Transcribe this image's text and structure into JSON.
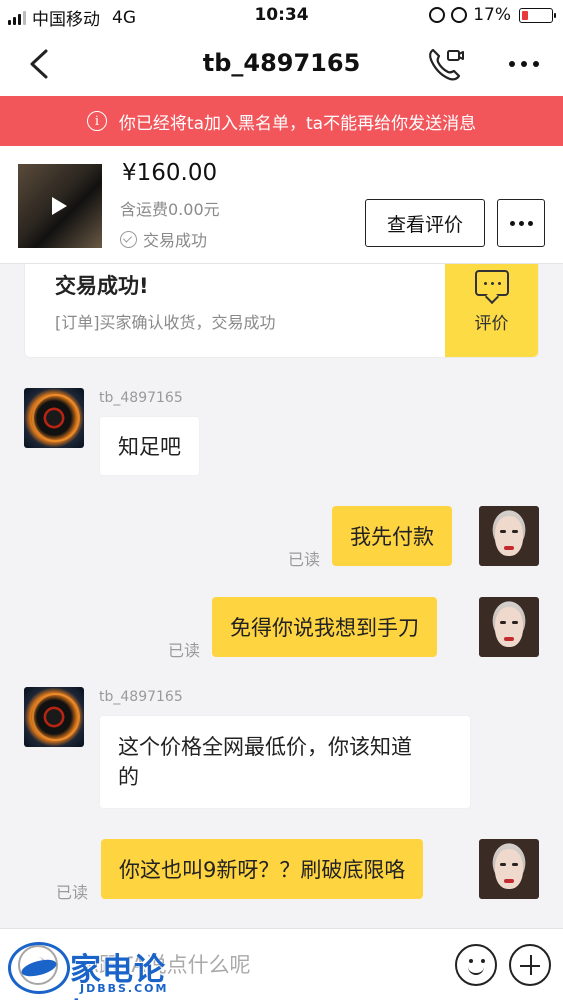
{
  "status_bar": {
    "carrier": "中国移动",
    "network": "4G",
    "time": "10:34",
    "battery": "17%",
    "battery_level": 0.17,
    "icons": [
      "lock-rotation-icon",
      "alarm-icon"
    ]
  },
  "nav": {
    "title": "tb_4897165",
    "icons": [
      "back-arrow-icon",
      "phone-video-icon",
      "more-dots-icon"
    ]
  },
  "banner": {
    "text": "你已经将ta加入黑名单，ta不能再给你发送消息",
    "color": "#f2565b"
  },
  "product": {
    "price": "¥160.00",
    "shipping": "含运费0.00元",
    "status": "交易成功",
    "review_button": "查看评价"
  },
  "transaction_card": {
    "title": "交易成功!",
    "subtitle": "[订单]买家确认收货，交易成功",
    "eval_label": "评价",
    "accent": "#fddb45"
  },
  "messages": [
    {
      "from": "seller",
      "sender": "tb_4897165",
      "text": "知足吧"
    },
    {
      "from": "me",
      "text": "我先付款",
      "read": "已读"
    },
    {
      "from": "me",
      "text": "免得你说我想到手刀",
      "read": "已读"
    },
    {
      "from": "seller",
      "sender": "tb_4897165",
      "text_line1": "这个价格全网最低价，你该知道",
      "text_line2": "的"
    },
    {
      "from": "me",
      "text": "你这也叫9新呀？？刷破底限咯",
      "read": "已读"
    }
  ],
  "input": {
    "placeholder": "想跟TA说点什么呢"
  },
  "watermark": {
    "text": "家电论坛",
    "sub": "JDBBS.COM"
  }
}
